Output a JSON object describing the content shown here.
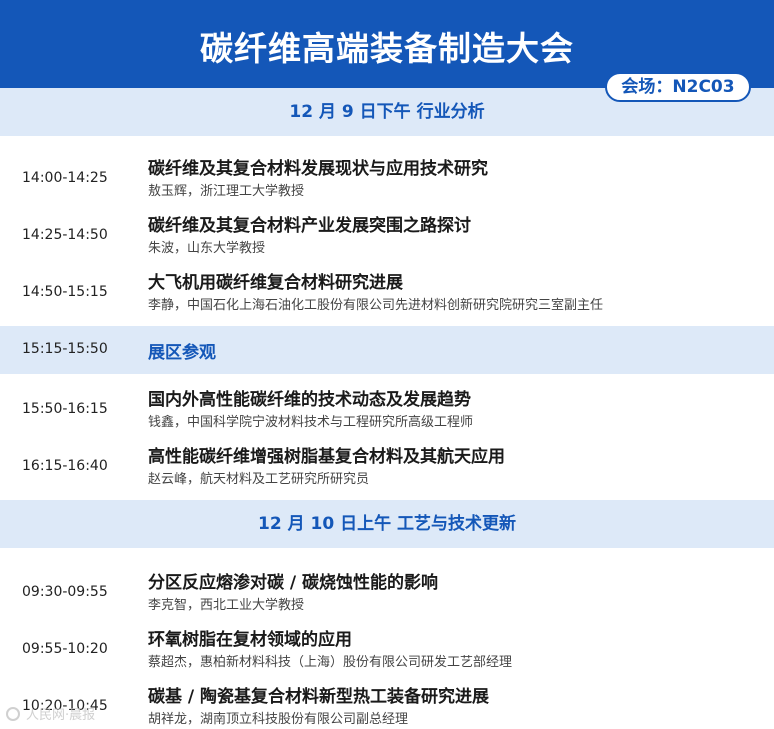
{
  "header": {
    "title": "碳纤维高端装备制造大会"
  },
  "venue": {
    "label": "会场：N2C03"
  },
  "sections": [
    {
      "heading": "12 月 9 日下午 行业分析",
      "sessions": [
        {
          "time": "14:00-14:25",
          "title": "碳纤维及其复合材料发展现状与应用技术研究",
          "speaker": "敖玉辉，浙江理工大学教授"
        },
        {
          "time": "14:25-14:50",
          "title": "碳纤维及其复合材料产业发展突围之路探讨",
          "speaker": "朱波，山东大学教授"
        },
        {
          "time": "14:50-15:15",
          "title": "大飞机用碳纤维复合材料研究进展",
          "speaker": "李静，中国石化上海石油化工股份有限公司先进材料创新研究院研究三室副主任"
        }
      ],
      "break": {
        "time": "15:15-15:50",
        "label": "展区参观"
      },
      "sessions_after": [
        {
          "time": "15:50-16:15",
          "title": "国内外高性能碳纤维的技术动态及发展趋势",
          "speaker": "钱鑫，中国科学院宁波材料技术与工程研究所高级工程师"
        },
        {
          "time": "16:15-16:40",
          "title": "高性能碳纤维增强树脂基复合材料及其航天应用",
          "speaker": "赵云峰，航天材料及工艺研究所研究员"
        }
      ]
    },
    {
      "heading": "12 月 10 日上午 工艺与技术更新",
      "sessions": [
        {
          "time": "09:30-09:55",
          "title": "分区反应熔渗对碳 / 碳烧蚀性能的影响",
          "speaker": "李克智，西北工业大学教授"
        },
        {
          "time": "09:55-10:20",
          "title": "环氧树脂在复材领域的应用",
          "speaker": "蔡超杰，惠柏新材料科技（上海）股份有限公司研发工艺部经理"
        },
        {
          "time": "10:20-10:45",
          "title": "碳基 / 陶瓷基复合材料新型热工装备研究进展",
          "speaker": "胡祥龙，湖南顶立科技股份有限公司副总经理"
        }
      ]
    }
  ],
  "watermark": {
    "text": "人民网·晨报"
  }
}
